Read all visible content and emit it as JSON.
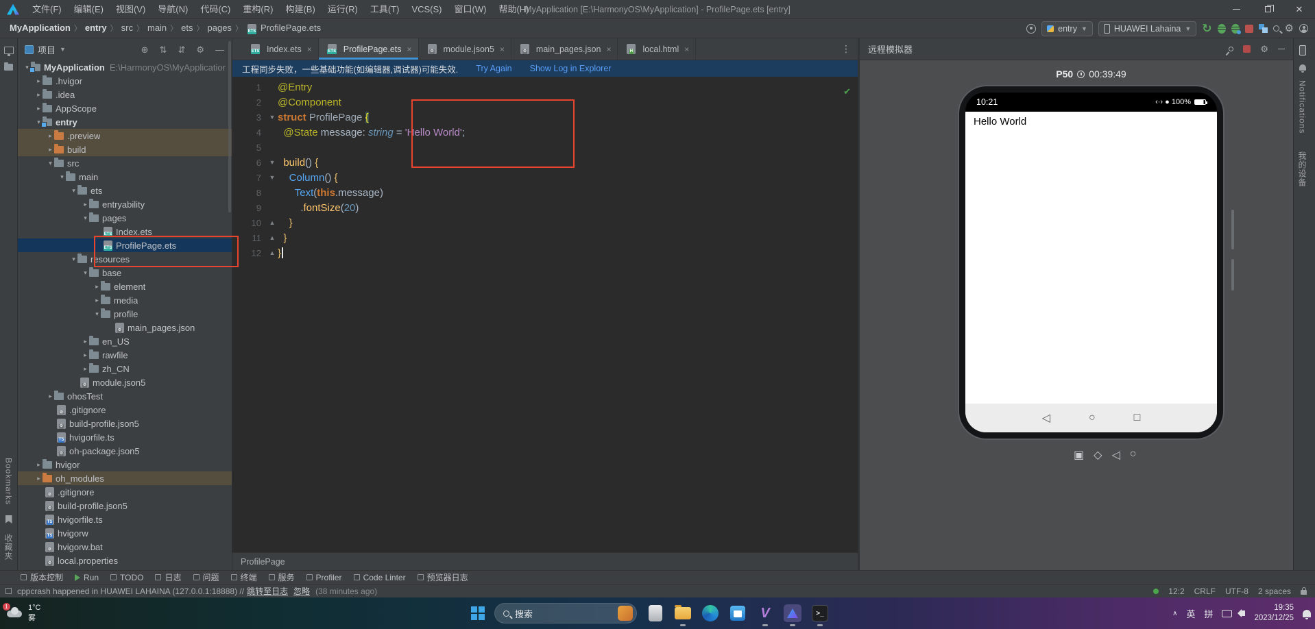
{
  "window": {
    "title": "MyApplication [E:\\HarmonyOS\\MyApplication] - ProfilePage.ets [entry]",
    "menus": [
      "文件(F)",
      "编辑(E)",
      "视图(V)",
      "导航(N)",
      "代码(C)",
      "重构(R)",
      "构建(B)",
      "运行(R)",
      "工具(T)",
      "VCS(S)",
      "窗口(W)",
      "帮助(H)"
    ]
  },
  "breadcrumbs": {
    "items": [
      "MyApplication",
      "entry",
      "src",
      "main",
      "ets",
      "pages"
    ],
    "file": "ProfilePage.ets"
  },
  "run_controls": {
    "module": "entry",
    "device": "HUAWEI Lahaina"
  },
  "project": {
    "title": "项目",
    "tree": [
      [
        "MyApplication",
        0,
        "root",
        1,
        0,
        "E:\\HarmonyOS\\MyApplicatior"
      ],
      [
        ".hvigor",
        1,
        "dir",
        2,
        0
      ],
      [
        ".idea",
        1,
        "dir",
        2,
        0
      ],
      [
        "AppScope",
        1,
        "dir",
        2,
        0
      ],
      [
        "entry",
        1,
        "mod",
        1,
        0
      ],
      [
        ".preview",
        2,
        "odir",
        2,
        1
      ],
      [
        "build",
        2,
        "odir",
        2,
        1
      ],
      [
        "src",
        2,
        "dir",
        1,
        0
      ],
      [
        "main",
        3,
        "dir",
        1,
        0
      ],
      [
        "ets",
        4,
        "dir",
        1,
        0
      ],
      [
        "entryability",
        5,
        "dir",
        2,
        0
      ],
      [
        "pages",
        5,
        "dir",
        1,
        0
      ],
      [
        "Index.ets",
        6,
        "ets",
        0,
        0
      ],
      [
        "ProfilePage.ets",
        6,
        "ets",
        0,
        2
      ],
      [
        "resources",
        4,
        "dir",
        1,
        0
      ],
      [
        "base",
        5,
        "dir",
        1,
        0
      ],
      [
        "element",
        6,
        "dir",
        2,
        0
      ],
      [
        "media",
        6,
        "dir",
        2,
        0
      ],
      [
        "profile",
        6,
        "dir",
        1,
        0
      ],
      [
        "main_pages.json",
        7,
        "json",
        0,
        0
      ],
      [
        "en_US",
        5,
        "dir",
        2,
        0
      ],
      [
        "rawfile",
        5,
        "dir",
        2,
        0
      ],
      [
        "zh_CN",
        5,
        "dir",
        2,
        0
      ],
      [
        "module.json5",
        4,
        "json",
        0,
        0
      ],
      [
        "ohosTest",
        2,
        "dir",
        2,
        0
      ],
      [
        ".gitignore",
        2,
        "git",
        0,
        0
      ],
      [
        "build-profile.json5",
        2,
        "json",
        0,
        0
      ],
      [
        "hvigorfile.ts",
        2,
        "ts",
        0,
        0
      ],
      [
        "oh-package.json5",
        2,
        "json",
        0,
        0
      ],
      [
        "hvigor",
        1,
        "dir",
        2,
        0
      ],
      [
        "oh_modules",
        1,
        "odir",
        2,
        1
      ],
      [
        ".gitignore",
        1,
        "git",
        0,
        0
      ],
      [
        "build-profile.json5",
        1,
        "json",
        0,
        0
      ],
      [
        "hvigorfile.ts",
        1,
        "ts",
        0,
        0
      ],
      [
        "hvigorw",
        1,
        "ts",
        0,
        0
      ],
      [
        "hvigorw.bat",
        1,
        "git",
        0,
        0
      ],
      [
        "local.properties",
        1,
        "json",
        0,
        0
      ]
    ]
  },
  "editor": {
    "tabs": [
      {
        "label": "Index.ets",
        "kind": "ets",
        "active": false
      },
      {
        "label": "ProfilePage.ets",
        "kind": "ets",
        "active": true
      },
      {
        "label": "module.json5",
        "kind": "json",
        "active": false
      },
      {
        "label": "main_pages.json",
        "kind": "json",
        "active": false
      },
      {
        "label": "local.html",
        "kind": "html",
        "active": false
      }
    ],
    "banner": {
      "message": "工程同步失败，一些基础功能(如编辑器,调试器)可能失效.",
      "actions": [
        "Try Again",
        "Show Log in Explorer"
      ]
    },
    "lines": [
      {
        "n": 1,
        "tk": [
          [
            "ann",
            "@Entry"
          ]
        ]
      },
      {
        "n": 2,
        "tk": [
          [
            "ann",
            "@Component"
          ]
        ]
      },
      {
        "n": 3,
        "f": "d",
        "tk": [
          [
            "kw",
            "struct "
          ],
          [
            "typ",
            "ProfilePage "
          ],
          [
            "bhl",
            "{"
          ]
        ]
      },
      {
        "n": 4,
        "tk": [
          [
            "pln",
            "  "
          ],
          [
            "ann",
            "@State"
          ],
          [
            "pln",
            " message: "
          ],
          [
            "tkw",
            "string"
          ],
          [
            "pln",
            " = "
          ],
          [
            "str",
            "'Hello World'"
          ],
          [
            "pln",
            ";"
          ]
        ]
      },
      {
        "n": 5,
        "tk": []
      },
      {
        "n": 6,
        "f": "d",
        "tk": [
          [
            "pln",
            "  "
          ],
          [
            "fn",
            "build"
          ],
          [
            "pln",
            "() "
          ],
          [
            "br",
            "{"
          ]
        ]
      },
      {
        "n": 7,
        "f": "d",
        "tk": [
          [
            "pln",
            "    "
          ],
          [
            "call",
            "Column"
          ],
          [
            "pln",
            "() "
          ],
          [
            "br",
            "{"
          ]
        ]
      },
      {
        "n": 8,
        "tk": [
          [
            "pln",
            "      "
          ],
          [
            "call",
            "Text"
          ],
          [
            "pln",
            "("
          ],
          [
            "kw",
            "this"
          ],
          [
            "pln",
            ".message)"
          ]
        ]
      },
      {
        "n": 9,
        "tk": [
          [
            "pln",
            "        ."
          ],
          [
            "fn",
            "fontSize"
          ],
          [
            "pln",
            "("
          ],
          [
            "num",
            "20"
          ],
          [
            "pln",
            ")"
          ]
        ]
      },
      {
        "n": 10,
        "f": "u",
        "tk": [
          [
            "pln",
            "    "
          ],
          [
            "br",
            "}"
          ]
        ]
      },
      {
        "n": 11,
        "f": "u",
        "tk": [
          [
            "pln",
            "  "
          ],
          [
            "br",
            "}"
          ]
        ]
      },
      {
        "n": 12,
        "f": "u",
        "caret": true,
        "tk": [
          [
            "br",
            "}"
          ]
        ]
      }
    ],
    "breadcrumb_bottom": "ProfilePage"
  },
  "emulator": {
    "panel_title": "远程模拟器",
    "device": "P50",
    "timer": "00:39:49",
    "phone": {
      "clock": "10:21",
      "status_right": "‹·› ● 100%",
      "content": "Hello World"
    }
  },
  "stripes": {
    "left_top": [
      "tool-window",
      "resource-manager"
    ],
    "left_bottom": [
      "Bookmarks",
      "收藏夹"
    ],
    "right": [
      "Notifications",
      "我的设备"
    ]
  },
  "bottom_bar": [
    "版本控制",
    "Run",
    "TODO",
    "日志",
    "问题",
    "终端",
    "服务",
    "Profiler",
    "Code Linter",
    "预览器日志"
  ],
  "status_bar": {
    "message": "cppcrash happened in HUAWEI LAHAINA (127.0.0.1:18888) //",
    "link": "跳转至日志",
    "ignore": "忽略",
    "ago": "(38 minutes ago)",
    "caret_pos": "12:2",
    "line_sep": "CRLF",
    "encoding": "UTF-8",
    "indent": "2 spaces"
  },
  "taskbar": {
    "weather_temp": "1°C",
    "weather_cond": "雾",
    "weather_badge": "1",
    "search_placeholder": "搜索",
    "tray_lang": [
      "英",
      "拼"
    ],
    "time": "19:35",
    "date": "2023/12/25"
  },
  "colors": {
    "accent_blue": "#3A93D6",
    "banner_bg": "#1D3D5F",
    "selection": "#14365A",
    "annotation_red": "#E8442E",
    "run_green": "#58A55C"
  }
}
